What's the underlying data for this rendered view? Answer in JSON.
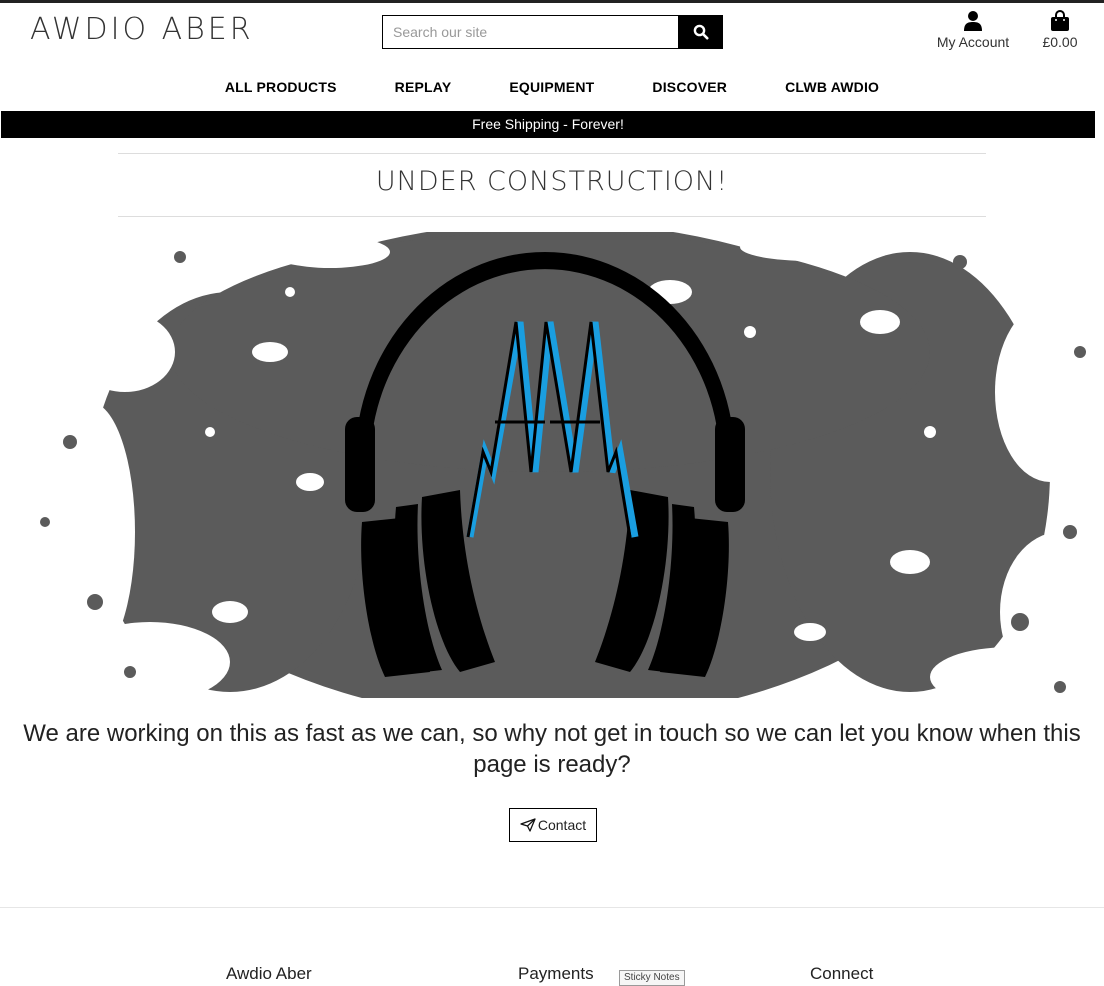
{
  "header": {
    "logo_text": "AWDIO ABER",
    "search": {
      "placeholder": "Search our site",
      "value": ""
    },
    "account_label": "My Account",
    "bag_total": "£0.00",
    "icons": {
      "search": "search-icon",
      "account": "user-icon",
      "bag": "shopping-bag-icon"
    }
  },
  "nav": {
    "items": [
      {
        "label": "ALL PRODUCTS"
      },
      {
        "label": "REPLAY"
      },
      {
        "label": "EQUIPMENT"
      },
      {
        "label": "DISCOVER"
      },
      {
        "label": "CLWB AWDIO"
      }
    ]
  },
  "banner": {
    "text": "Free Shipping - Forever!"
  },
  "main": {
    "title": "UNDER CONSTRUCTION!",
    "hero_image": {
      "depicts": "headphones-logo-ink-splatter",
      "colors": {
        "splatter": "#5a5a5a",
        "headphones": "#000000",
        "accent": "#1a9ee0"
      }
    },
    "message": "We are working on this as fast as we can, so why not get in touch so we can let you know when this page is ready?",
    "contact_button": {
      "label": "Contact",
      "icon": "paper-plane-icon"
    }
  },
  "footer": {
    "headings": [
      {
        "label": "Awdio Aber"
      },
      {
        "label": "Payments"
      },
      {
        "label": "Connect"
      }
    ],
    "sticky_note_label": "Sticky Notes"
  },
  "colors": {
    "banner_bg": "#000000",
    "banner_text": "#ffffff",
    "accent": "#1a9ee0"
  }
}
